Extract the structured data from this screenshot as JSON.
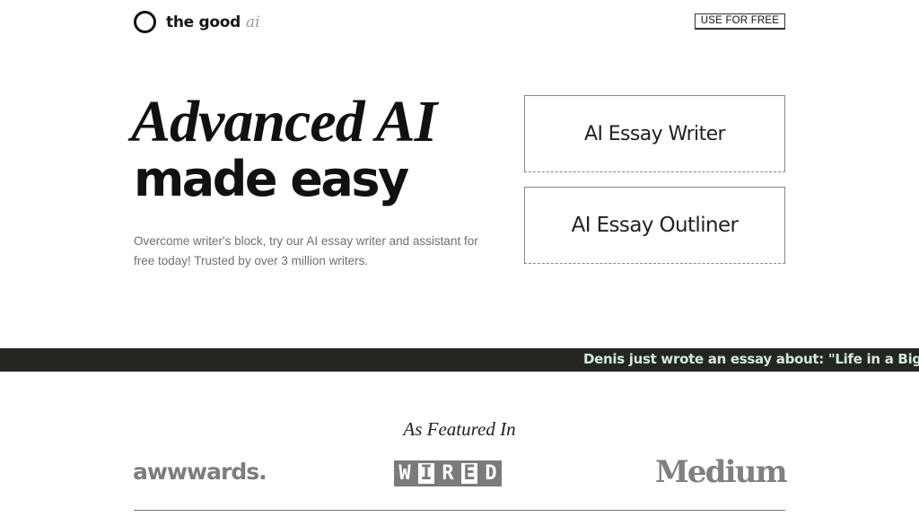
{
  "header": {
    "logo_text": "the good",
    "logo_ai": "ai",
    "cta_label": "USE FOR FREE"
  },
  "hero": {
    "headline_line1": "Advanced AI",
    "headline_line2": "made easy",
    "subtitle": "Overcome writer's block, try our AI essay writer and assistant for free today! Trusted by over 3 million writers."
  },
  "tools": [
    {
      "label": "AI Essay Writer"
    },
    {
      "label": "AI Essay Outliner"
    }
  ],
  "ticker": {
    "text": "Denis just wrote an essay about: \"Life in a Big City\""
  },
  "featured": {
    "title": "As Featured In",
    "logos": [
      "awwwards.",
      "WIRED",
      "Medium"
    ]
  },
  "icons": {
    "logo": "circle-logo-icon"
  }
}
